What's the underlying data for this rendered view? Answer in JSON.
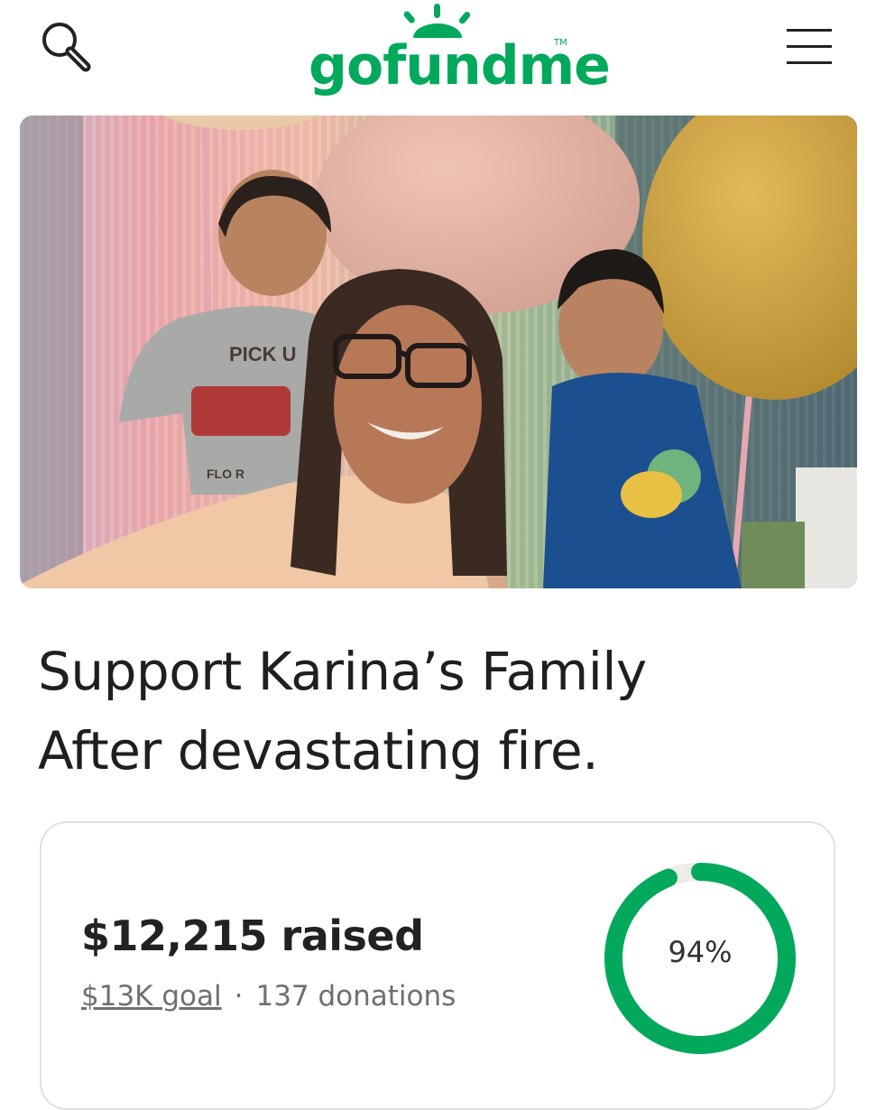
{
  "header": {
    "logo_text": "gofundme",
    "logo_tm": "TM",
    "brand_color": "#02a95c",
    "search_icon": "search-icon",
    "menu_icon": "hamburger-menu-icon"
  },
  "campaign": {
    "title_line1": "Support Karina’s Family",
    "title_line2": "After devastating fire.",
    "hero_shirt_text": "PICK U",
    "hero_shirt_text2": "FLO R"
  },
  "progress": {
    "amount": "$12,215",
    "raised_label": "raised",
    "goal": "$13K goal",
    "separator": "·",
    "donations": "137 donations",
    "percent_label": "94%",
    "fraction": 0.94,
    "ring_color": "#02a95c",
    "track_color": "#eeece7"
  }
}
